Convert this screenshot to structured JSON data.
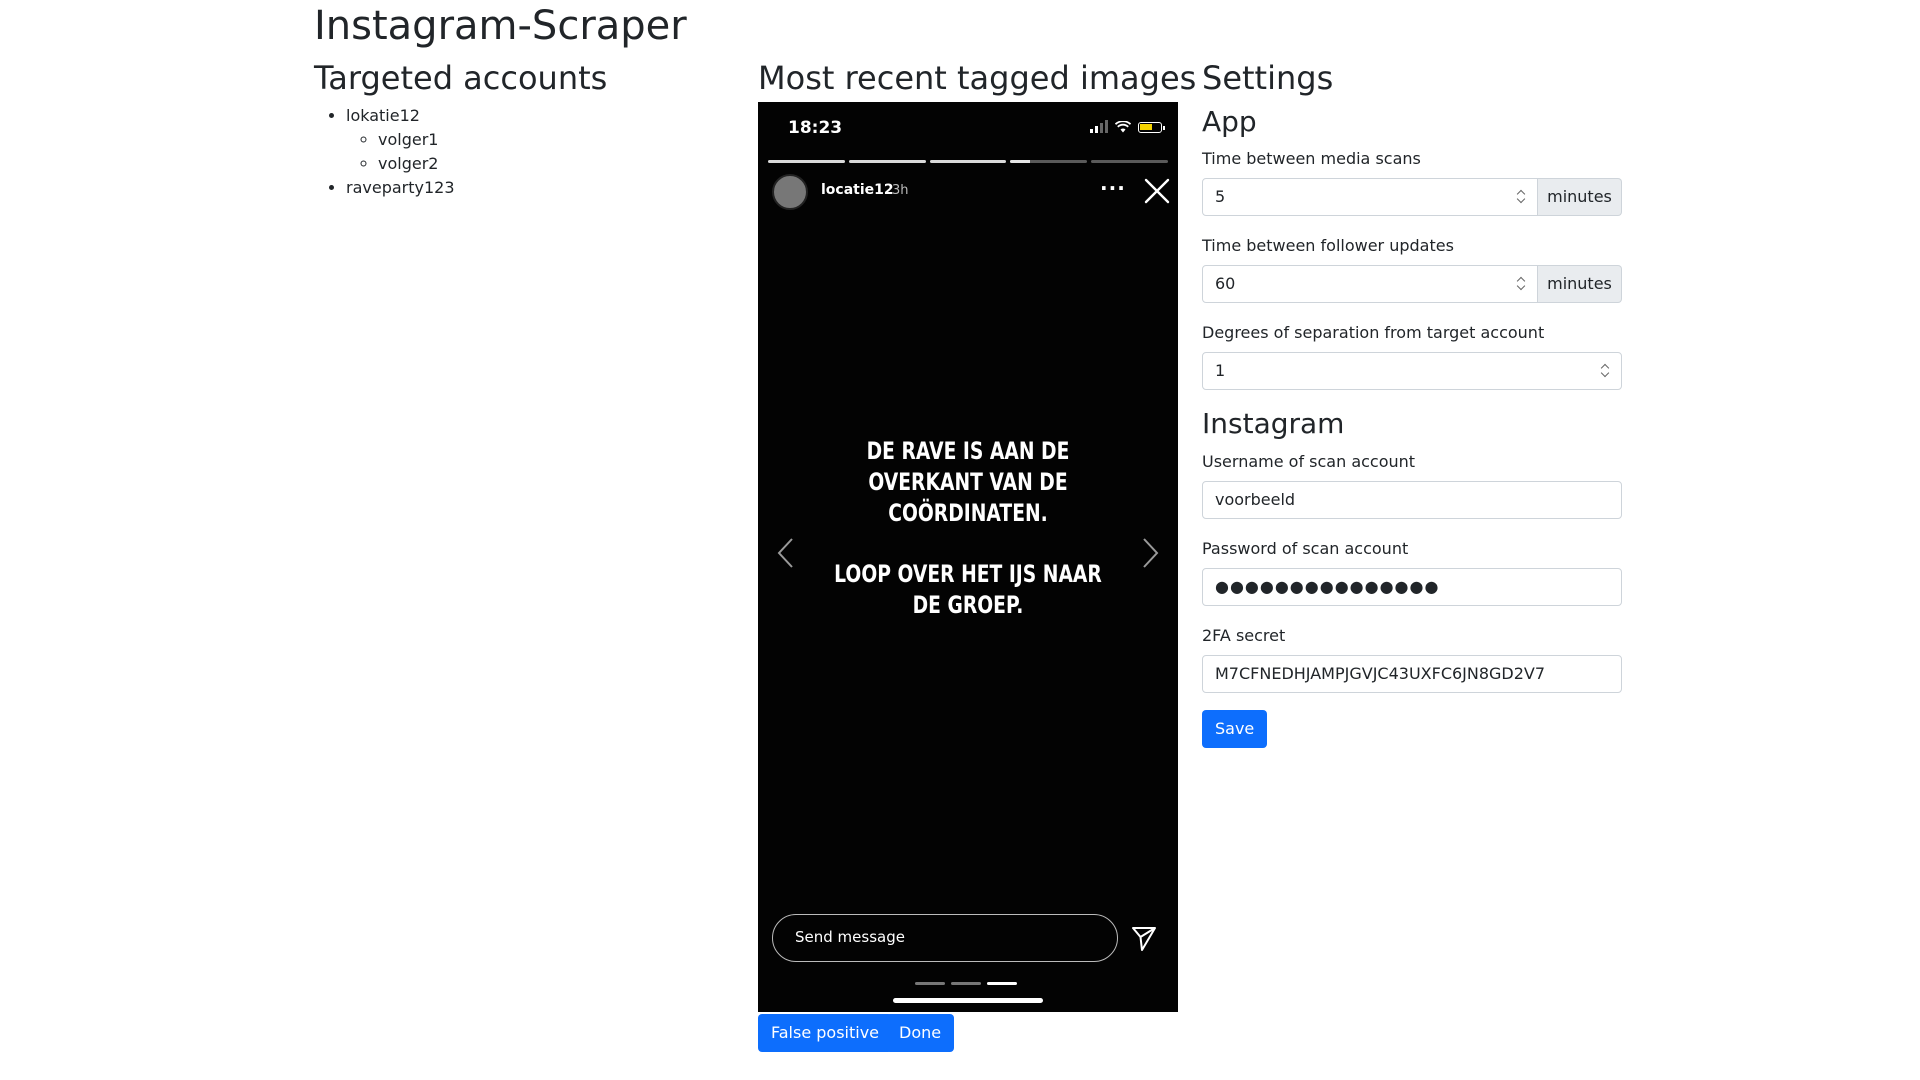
{
  "app_title": "Instagram-Scraper",
  "targets": {
    "title": "Targeted accounts",
    "accounts": [
      {
        "name": "lokatie12",
        "followers": [
          "volger1",
          "volger2"
        ]
      },
      {
        "name": "raveparty123",
        "followers": []
      }
    ]
  },
  "images": {
    "title": "Most recent tagged images",
    "story": {
      "time": "18:23",
      "username": "locatie12",
      "age": "3h",
      "more": "···",
      "text_line1": "DE RAVE IS AAN DE OVERKANT VAN DE COÖRDINATEN.",
      "text_line2": "LOOP OVER HET IJS NAAR DE GROEP.",
      "message_placeholder": "Send message",
      "progress": {
        "segments": 5,
        "complete": 3,
        "current_fraction": 0.25
      },
      "page_dots": {
        "count": 3,
        "active": 3
      }
    },
    "false_positive_label": "False positive",
    "done_label": "Done"
  },
  "settings": {
    "title": "Settings",
    "app_title": "App",
    "media_scans_label": "Time between media scans",
    "media_scans_value": "5",
    "follower_updates_label": "Time between follower updates",
    "follower_updates_value": "60",
    "unit": "minutes",
    "degrees_label": "Degrees of separation from target account",
    "degrees_value": "1",
    "instagram_title": "Instagram",
    "username_label": "Username of scan account",
    "username_value": "voorbeeld",
    "password_label": "Password of scan account",
    "password_value": "●●●●●●●●●●●●●●●",
    "twofa_label": "2FA secret",
    "twofa_value": "M7CFNEDHJAMPJGVJC43UXFC6JN8GD2V7",
    "save_label": "Save"
  },
  "colors": {
    "primary": "#0d6efd",
    "text": "#212529",
    "addon_bg": "#e9ecef",
    "border": "#ced4da",
    "story_bg": "#030303"
  }
}
